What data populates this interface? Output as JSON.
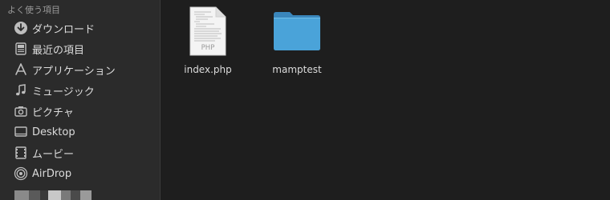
{
  "sidebar": {
    "section_title": "よく使う項目",
    "items": [
      {
        "label": "ダウンロード",
        "icon": "download-icon"
      },
      {
        "label": "最近の項目",
        "icon": "recents-icon"
      },
      {
        "label": "アプリケーション",
        "icon": "applications-icon"
      },
      {
        "label": "ミュージック",
        "icon": "music-icon"
      },
      {
        "label": "ピクチャ",
        "icon": "pictures-icon"
      },
      {
        "label": "Desktop",
        "icon": "desktop-icon"
      },
      {
        "label": "ムービー",
        "icon": "movies-icon"
      },
      {
        "label": "AirDrop",
        "icon": "airdrop-icon"
      }
    ]
  },
  "files": [
    {
      "name": "index.php",
      "icon": "php-file-icon",
      "badge": "PHP"
    },
    {
      "name": "mamptest",
      "icon": "folder-icon"
    }
  ],
  "colors": {
    "sidebar_bg": "#2b2b2b",
    "content_bg": "#1e1e1e",
    "folder_blue": "#4aa3d9",
    "text": "#dcdcdc",
    "section_header": "#9a9a9a"
  }
}
